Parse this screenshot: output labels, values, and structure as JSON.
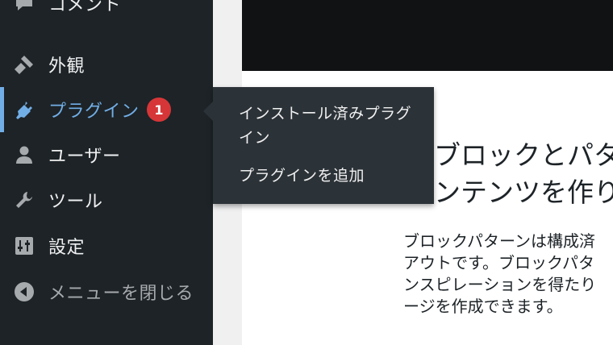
{
  "sidebar": {
    "items": [
      {
        "label": "コメント",
        "icon": "comment-icon"
      },
      {
        "label": "外観",
        "icon": "paintbrush-icon"
      },
      {
        "label": "プラグイン",
        "icon": "plugin-icon",
        "active": true,
        "badge": "1"
      },
      {
        "label": "ユーザー",
        "icon": "user-icon"
      },
      {
        "label": "ツール",
        "icon": "wrench-icon"
      },
      {
        "label": "設定",
        "icon": "settings-sliders-icon"
      },
      {
        "label": "メニューを閉じる",
        "icon": "collapse-arrow-icon"
      }
    ]
  },
  "flyout": {
    "items": [
      {
        "label": "インストール済みプラグイン"
      },
      {
        "label": "プラグインを追加"
      }
    ]
  },
  "content": {
    "heading_lines": [
      "ブロックとパター",
      "ンテンツを作り"
    ],
    "description_lines": [
      "ブロックパターンは構成済",
      "アウトです。ブロックパタ",
      "ンスピレーションを得たり",
      "ージを作成できます。"
    ]
  },
  "colors": {
    "sidebar_bg": "#1d2327",
    "flyout_bg": "#2c3338",
    "accent": "#72aee6",
    "badge": "#d63638"
  }
}
